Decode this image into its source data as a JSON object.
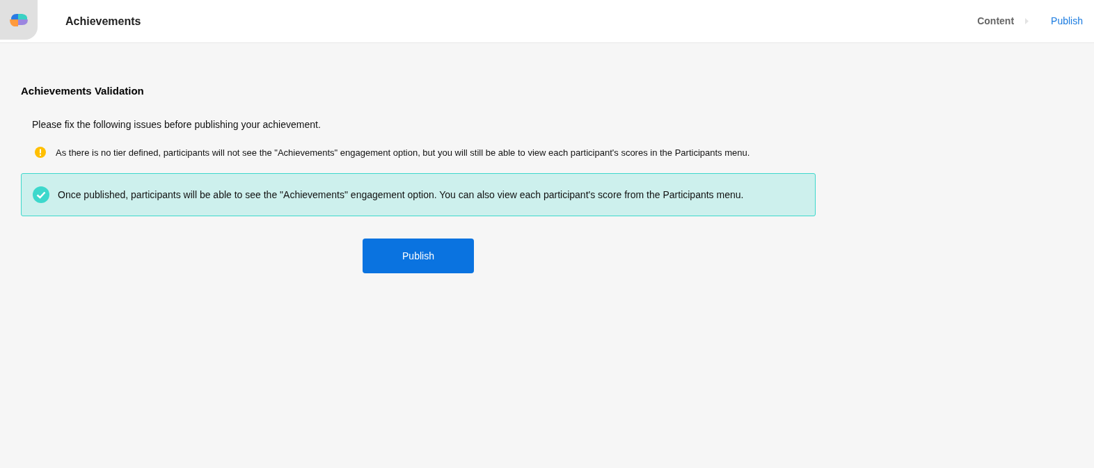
{
  "header": {
    "title": "Achievements"
  },
  "steps": [
    {
      "label": "Content",
      "selected": false
    },
    {
      "label": "Publish",
      "selected": true
    }
  ],
  "validation": {
    "title": "Achievements Validation",
    "intro": "Please fix the following issues before publishing your achievement.",
    "issues": [
      {
        "kind": "warning",
        "text": "As there is no tier defined, participants will not see the \"Achievements\" engagement option, but you will still be able to view each participant's scores in the Participants menu."
      }
    ],
    "success": "Once published, participants will be able to see the \"Achievements\" engagement option. You can also view each participant's score from the Participants menu."
  },
  "publish_button": "Publish"
}
